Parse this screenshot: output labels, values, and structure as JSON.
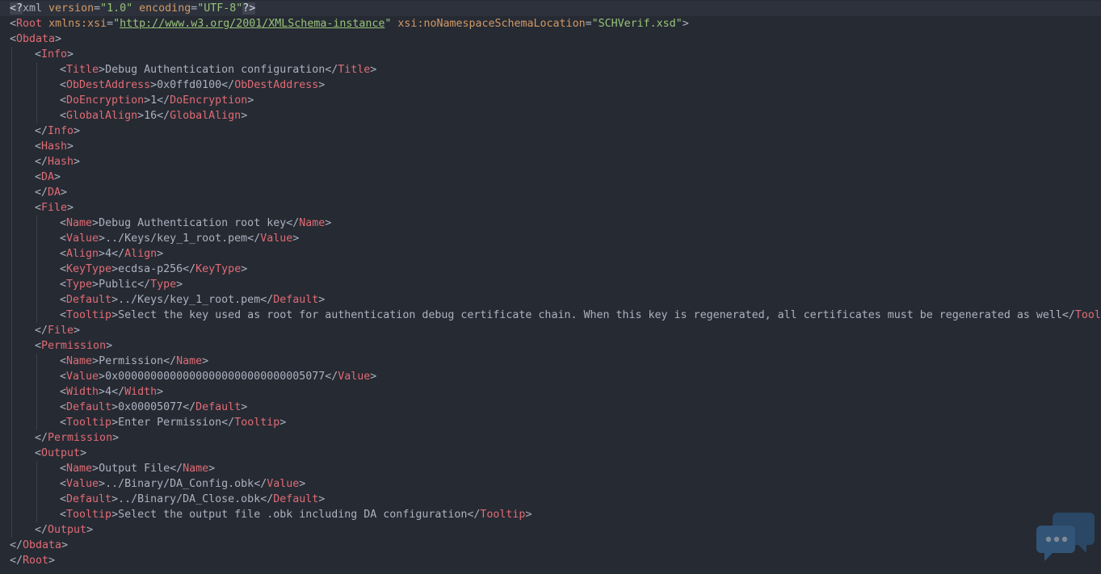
{
  "colors": {
    "background": "#262a33",
    "tag": "#e06c75",
    "attribute": "#d19a66",
    "string": "#98c379",
    "text": "#abb2bf"
  },
  "lines": [
    {
      "indent": 0,
      "tokens": [
        {
          "c": "decl-bracket",
          "v": "<?"
        },
        {
          "c": "decl",
          "v": "xml "
        },
        {
          "c": "a",
          "v": "version"
        },
        {
          "c": "p",
          "v": "="
        },
        {
          "c": "s",
          "v": "\"1.0\""
        },
        {
          "c": "p",
          "v": " "
        },
        {
          "c": "a",
          "v": "encoding"
        },
        {
          "c": "p",
          "v": "="
        },
        {
          "c": "s",
          "v": "\"UTF-8\""
        },
        {
          "c": "decl-bracket",
          "v": "?>"
        }
      ]
    },
    {
      "indent": 0,
      "tokens": [
        {
          "c": "p",
          "v": "<"
        },
        {
          "c": "t",
          "v": "Root"
        },
        {
          "c": "p",
          "v": " "
        },
        {
          "c": "a",
          "v": "xmlns:xsi"
        },
        {
          "c": "p",
          "v": "="
        },
        {
          "c": "s",
          "v": "\""
        },
        {
          "c": "u",
          "v": "http://www.w3.org/2001/XMLSchema-instance"
        },
        {
          "c": "s",
          "v": "\""
        },
        {
          "c": "p",
          "v": " "
        },
        {
          "c": "a",
          "v": "xsi:noNamespaceSchemaLocation"
        },
        {
          "c": "p",
          "v": "="
        },
        {
          "c": "s",
          "v": "\"SCHVerif.xsd\""
        },
        {
          "c": "p",
          "v": ">"
        }
      ]
    },
    {
      "indent": 0,
      "tokens": [
        {
          "c": "p",
          "v": "<"
        },
        {
          "c": "t",
          "v": "Obdata"
        },
        {
          "c": "p",
          "v": ">"
        }
      ]
    },
    {
      "indent": 1,
      "tokens": [
        {
          "c": "p",
          "v": "<"
        },
        {
          "c": "t",
          "v": "Info"
        },
        {
          "c": "p",
          "v": ">"
        }
      ]
    },
    {
      "indent": 2,
      "tokens": [
        {
          "c": "p",
          "v": "<"
        },
        {
          "c": "t",
          "v": "Title"
        },
        {
          "c": "p",
          "v": ">"
        },
        {
          "c": "x",
          "v": "Debug Authentication configuration"
        },
        {
          "c": "p",
          "v": "</"
        },
        {
          "c": "t",
          "v": "Title"
        },
        {
          "c": "p",
          "v": ">"
        }
      ]
    },
    {
      "indent": 2,
      "tokens": [
        {
          "c": "p",
          "v": "<"
        },
        {
          "c": "t",
          "v": "ObDestAddress"
        },
        {
          "c": "p",
          "v": ">"
        },
        {
          "c": "x",
          "v": "0x0ffd0100"
        },
        {
          "c": "p",
          "v": "</"
        },
        {
          "c": "t",
          "v": "ObDestAddress"
        },
        {
          "c": "p",
          "v": ">"
        }
      ]
    },
    {
      "indent": 2,
      "tokens": [
        {
          "c": "p",
          "v": "<"
        },
        {
          "c": "t",
          "v": "DoEncryption"
        },
        {
          "c": "p",
          "v": ">"
        },
        {
          "c": "x",
          "v": "1"
        },
        {
          "c": "p",
          "v": "</"
        },
        {
          "c": "t",
          "v": "DoEncryption"
        },
        {
          "c": "p",
          "v": ">"
        }
      ]
    },
    {
      "indent": 2,
      "tokens": [
        {
          "c": "p",
          "v": "<"
        },
        {
          "c": "t",
          "v": "GlobalAlign"
        },
        {
          "c": "p",
          "v": ">"
        },
        {
          "c": "x",
          "v": "16"
        },
        {
          "c": "p",
          "v": "</"
        },
        {
          "c": "t",
          "v": "GlobalAlign"
        },
        {
          "c": "p",
          "v": ">"
        }
      ]
    },
    {
      "indent": 1,
      "tokens": [
        {
          "c": "p",
          "v": "</"
        },
        {
          "c": "t",
          "v": "Info"
        },
        {
          "c": "p",
          "v": ">"
        }
      ]
    },
    {
      "indent": 1,
      "tokens": [
        {
          "c": "p",
          "v": "<"
        },
        {
          "c": "t",
          "v": "Hash"
        },
        {
          "c": "p",
          "v": ">"
        }
      ]
    },
    {
      "indent": 1,
      "tokens": [
        {
          "c": "p",
          "v": "</"
        },
        {
          "c": "t",
          "v": "Hash"
        },
        {
          "c": "p",
          "v": ">"
        }
      ]
    },
    {
      "indent": 1,
      "tokens": [
        {
          "c": "p",
          "v": "<"
        },
        {
          "c": "t",
          "v": "DA"
        },
        {
          "c": "p",
          "v": ">"
        }
      ]
    },
    {
      "indent": 1,
      "tokens": [
        {
          "c": "p",
          "v": "</"
        },
        {
          "c": "t",
          "v": "DA"
        },
        {
          "c": "p",
          "v": ">"
        }
      ]
    },
    {
      "indent": 1,
      "tokens": [
        {
          "c": "p",
          "v": "<"
        },
        {
          "c": "t",
          "v": "File"
        },
        {
          "c": "p",
          "v": ">"
        }
      ]
    },
    {
      "indent": 2,
      "tokens": [
        {
          "c": "p",
          "v": "<"
        },
        {
          "c": "t",
          "v": "Name"
        },
        {
          "c": "p",
          "v": ">"
        },
        {
          "c": "x",
          "v": "Debug Authentication root key"
        },
        {
          "c": "p",
          "v": "</"
        },
        {
          "c": "t",
          "v": "Name"
        },
        {
          "c": "p",
          "v": ">"
        }
      ]
    },
    {
      "indent": 2,
      "tokens": [
        {
          "c": "p",
          "v": "<"
        },
        {
          "c": "t",
          "v": "Value"
        },
        {
          "c": "p",
          "v": ">"
        },
        {
          "c": "x",
          "v": "../Keys/key_1_root.pem"
        },
        {
          "c": "p",
          "v": "</"
        },
        {
          "c": "t",
          "v": "Value"
        },
        {
          "c": "p",
          "v": ">"
        }
      ]
    },
    {
      "indent": 2,
      "tokens": [
        {
          "c": "p",
          "v": "<"
        },
        {
          "c": "t",
          "v": "Align"
        },
        {
          "c": "p",
          "v": ">"
        },
        {
          "c": "x",
          "v": "4"
        },
        {
          "c": "p",
          "v": "</"
        },
        {
          "c": "t",
          "v": "Align"
        },
        {
          "c": "p",
          "v": ">"
        }
      ]
    },
    {
      "indent": 2,
      "tokens": [
        {
          "c": "p",
          "v": "<"
        },
        {
          "c": "t",
          "v": "KeyType"
        },
        {
          "c": "p",
          "v": ">"
        },
        {
          "c": "x",
          "v": "ecdsa-p256"
        },
        {
          "c": "p",
          "v": "</"
        },
        {
          "c": "t",
          "v": "KeyType"
        },
        {
          "c": "p",
          "v": ">"
        }
      ]
    },
    {
      "indent": 2,
      "tokens": [
        {
          "c": "p",
          "v": "<"
        },
        {
          "c": "t",
          "v": "Type"
        },
        {
          "c": "p",
          "v": ">"
        },
        {
          "c": "x",
          "v": "Public"
        },
        {
          "c": "p",
          "v": "</"
        },
        {
          "c": "t",
          "v": "Type"
        },
        {
          "c": "p",
          "v": ">"
        }
      ]
    },
    {
      "indent": 2,
      "tokens": [
        {
          "c": "p",
          "v": "<"
        },
        {
          "c": "t",
          "v": "Default"
        },
        {
          "c": "p",
          "v": ">"
        },
        {
          "c": "x",
          "v": "../Keys/key_1_root.pem"
        },
        {
          "c": "p",
          "v": "</"
        },
        {
          "c": "t",
          "v": "Default"
        },
        {
          "c": "p",
          "v": ">"
        }
      ]
    },
    {
      "indent": 2,
      "tokens": [
        {
          "c": "p",
          "v": "<"
        },
        {
          "c": "t",
          "v": "Tooltip"
        },
        {
          "c": "p",
          "v": ">"
        },
        {
          "c": "x",
          "v": "Select the key used as root for authentication debug certificate chain. When this key is regenerated, all certificates must be regenerated as well"
        },
        {
          "c": "p",
          "v": "</"
        },
        {
          "c": "t",
          "v": "Tooltip"
        },
        {
          "c": "p",
          "v": ">"
        }
      ]
    },
    {
      "indent": 1,
      "tokens": [
        {
          "c": "p",
          "v": "</"
        },
        {
          "c": "t",
          "v": "File"
        },
        {
          "c": "p",
          "v": ">"
        }
      ]
    },
    {
      "indent": 1,
      "tokens": [
        {
          "c": "p",
          "v": "<"
        },
        {
          "c": "t",
          "v": "Permission"
        },
        {
          "c": "p",
          "v": ">"
        }
      ]
    },
    {
      "indent": 2,
      "tokens": [
        {
          "c": "p",
          "v": "<"
        },
        {
          "c": "t",
          "v": "Name"
        },
        {
          "c": "p",
          "v": ">"
        },
        {
          "c": "x",
          "v": "Permission"
        },
        {
          "c": "p",
          "v": "</"
        },
        {
          "c": "t",
          "v": "Name"
        },
        {
          "c": "p",
          "v": ">"
        }
      ]
    },
    {
      "indent": 2,
      "tokens": [
        {
          "c": "p",
          "v": "<"
        },
        {
          "c": "t",
          "v": "Value"
        },
        {
          "c": "p",
          "v": ">"
        },
        {
          "c": "x",
          "v": "0x00000000000000000000000000005077"
        },
        {
          "c": "p",
          "v": "</"
        },
        {
          "c": "t",
          "v": "Value"
        },
        {
          "c": "p",
          "v": ">"
        }
      ]
    },
    {
      "indent": 2,
      "tokens": [
        {
          "c": "p",
          "v": "<"
        },
        {
          "c": "t",
          "v": "Width"
        },
        {
          "c": "p",
          "v": ">"
        },
        {
          "c": "x",
          "v": "4"
        },
        {
          "c": "p",
          "v": "</"
        },
        {
          "c": "t",
          "v": "Width"
        },
        {
          "c": "p",
          "v": ">"
        }
      ]
    },
    {
      "indent": 2,
      "tokens": [
        {
          "c": "p",
          "v": "<"
        },
        {
          "c": "t",
          "v": "Default"
        },
        {
          "c": "p",
          "v": ">"
        },
        {
          "c": "x",
          "v": "0x00005077"
        },
        {
          "c": "p",
          "v": "</"
        },
        {
          "c": "t",
          "v": "Default"
        },
        {
          "c": "p",
          "v": ">"
        }
      ]
    },
    {
      "indent": 2,
      "tokens": [
        {
          "c": "p",
          "v": "<"
        },
        {
          "c": "t",
          "v": "Tooltip"
        },
        {
          "c": "p",
          "v": ">"
        },
        {
          "c": "x",
          "v": "Enter Permission"
        },
        {
          "c": "p",
          "v": "</"
        },
        {
          "c": "t",
          "v": "Tooltip"
        },
        {
          "c": "p",
          "v": ">"
        }
      ]
    },
    {
      "indent": 1,
      "tokens": [
        {
          "c": "p",
          "v": "</"
        },
        {
          "c": "t",
          "v": "Permission"
        },
        {
          "c": "p",
          "v": ">"
        }
      ]
    },
    {
      "indent": 1,
      "tokens": [
        {
          "c": "p",
          "v": "<"
        },
        {
          "c": "t",
          "v": "Output"
        },
        {
          "c": "p",
          "v": ">"
        }
      ]
    },
    {
      "indent": 2,
      "tokens": [
        {
          "c": "p",
          "v": "<"
        },
        {
          "c": "t",
          "v": "Name"
        },
        {
          "c": "p",
          "v": ">"
        },
        {
          "c": "x",
          "v": "Output File"
        },
        {
          "c": "p",
          "v": "</"
        },
        {
          "c": "t",
          "v": "Name"
        },
        {
          "c": "p",
          "v": ">"
        }
      ]
    },
    {
      "indent": 2,
      "tokens": [
        {
          "c": "p",
          "v": "<"
        },
        {
          "c": "t",
          "v": "Value"
        },
        {
          "c": "p",
          "v": ">"
        },
        {
          "c": "x",
          "v": "../Binary/DA_Config.obk"
        },
        {
          "c": "p",
          "v": "</"
        },
        {
          "c": "t",
          "v": "Value"
        },
        {
          "c": "p",
          "v": ">"
        }
      ]
    },
    {
      "indent": 2,
      "tokens": [
        {
          "c": "p",
          "v": "<"
        },
        {
          "c": "t",
          "v": "Default"
        },
        {
          "c": "p",
          "v": ">"
        },
        {
          "c": "x",
          "v": "../Binary/DA_Close.obk"
        },
        {
          "c": "p",
          "v": "</"
        },
        {
          "c": "t",
          "v": "Default"
        },
        {
          "c": "p",
          "v": ">"
        }
      ]
    },
    {
      "indent": 2,
      "tokens": [
        {
          "c": "p",
          "v": "<"
        },
        {
          "c": "t",
          "v": "Tooltip"
        },
        {
          "c": "p",
          "v": ">"
        },
        {
          "c": "x",
          "v": "Select the output file .obk including DA configuration"
        },
        {
          "c": "p",
          "v": "</"
        },
        {
          "c": "t",
          "v": "Tooltip"
        },
        {
          "c": "p",
          "v": ">"
        }
      ]
    },
    {
      "indent": 1,
      "tokens": [
        {
          "c": "p",
          "v": "</"
        },
        {
          "c": "t",
          "v": "Output"
        },
        {
          "c": "p",
          "v": ">"
        }
      ]
    },
    {
      "indent": 0,
      "tokens": [
        {
          "c": "p",
          "v": "</"
        },
        {
          "c": "t",
          "v": "Obdata"
        },
        {
          "c": "p",
          "v": ">"
        }
      ]
    },
    {
      "indent": 0,
      "tokens": [
        {
          "c": "p",
          "v": "</"
        },
        {
          "c": "t",
          "v": "Root"
        },
        {
          "c": "p",
          "v": ">"
        }
      ]
    }
  ],
  "watermark_icon": "chat-bubbles-icon"
}
